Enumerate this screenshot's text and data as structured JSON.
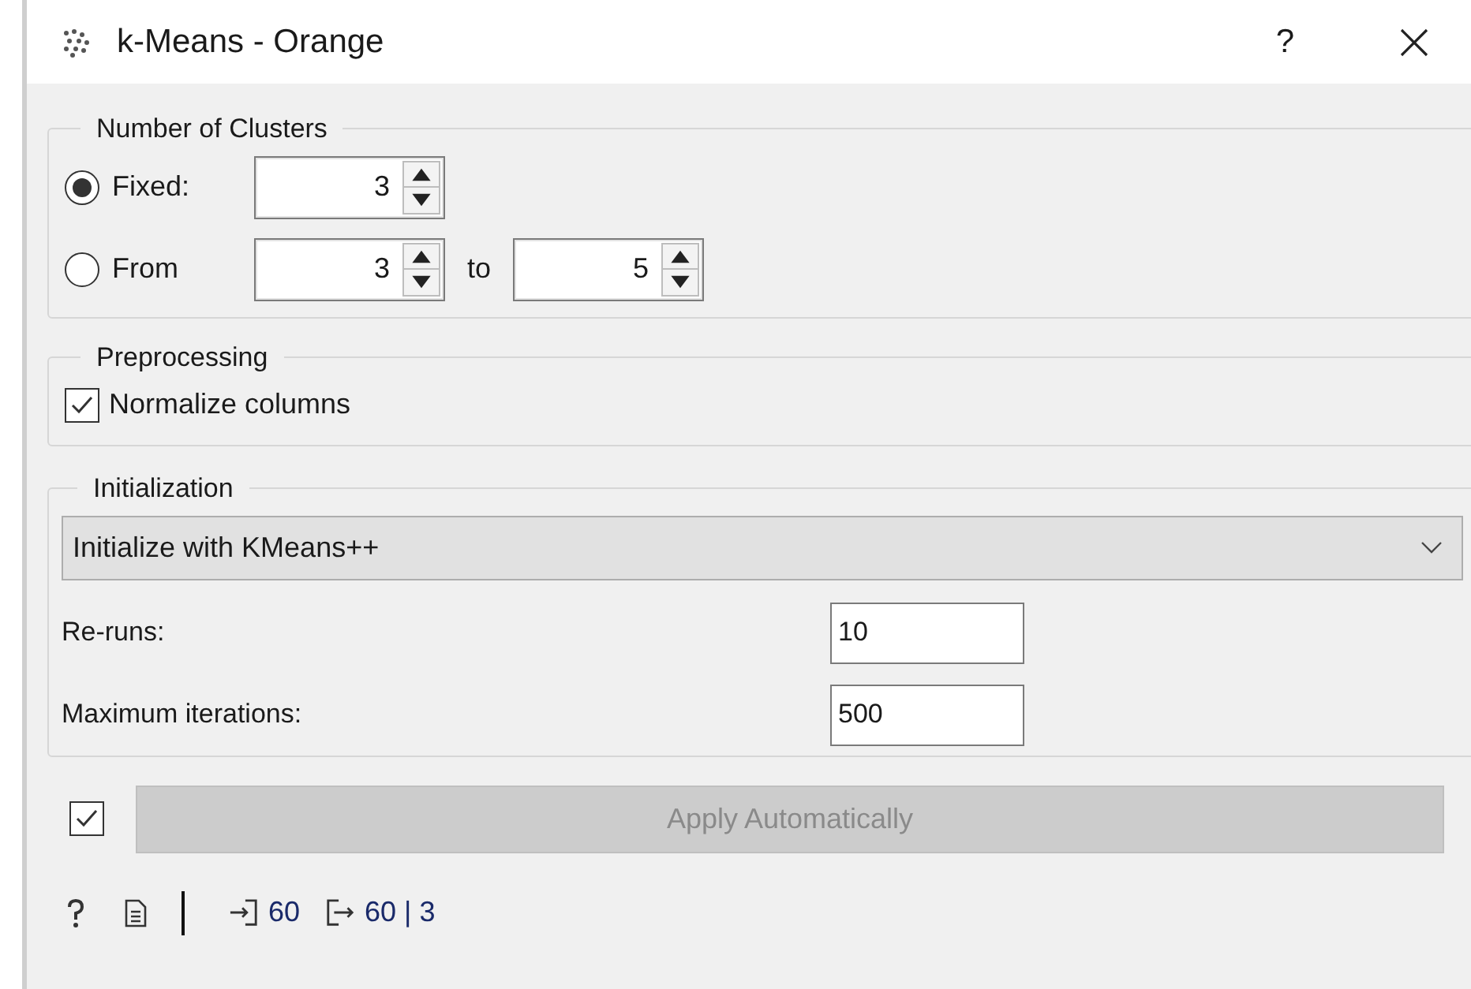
{
  "window": {
    "title": "k-Means - Orange",
    "help": "?"
  },
  "number_of_clusters": {
    "title": "Number of Clusters",
    "options": [
      {
        "label": "Fixed:",
        "selected": true,
        "values": [
          "3"
        ]
      },
      {
        "label": "From",
        "selected": false,
        "values": [
          "3",
          "5"
        ],
        "separator": "to"
      }
    ]
  },
  "preprocessing": {
    "title": "Preprocessing",
    "checkbox": {
      "label": "Normalize columns",
      "checked": true
    }
  },
  "initialization": {
    "title": "Initialization",
    "method": "Initialize with KMeans++",
    "rows": [
      {
        "label": "Re-runs:",
        "value": "10"
      },
      {
        "label": "Maximum iterations:",
        "value": "500"
      }
    ]
  },
  "apply": {
    "checked": true,
    "label": "Apply Automatically",
    "disabled": true
  },
  "status_bar": {
    "input_count": "60",
    "output_count": "60 | 3"
  }
}
